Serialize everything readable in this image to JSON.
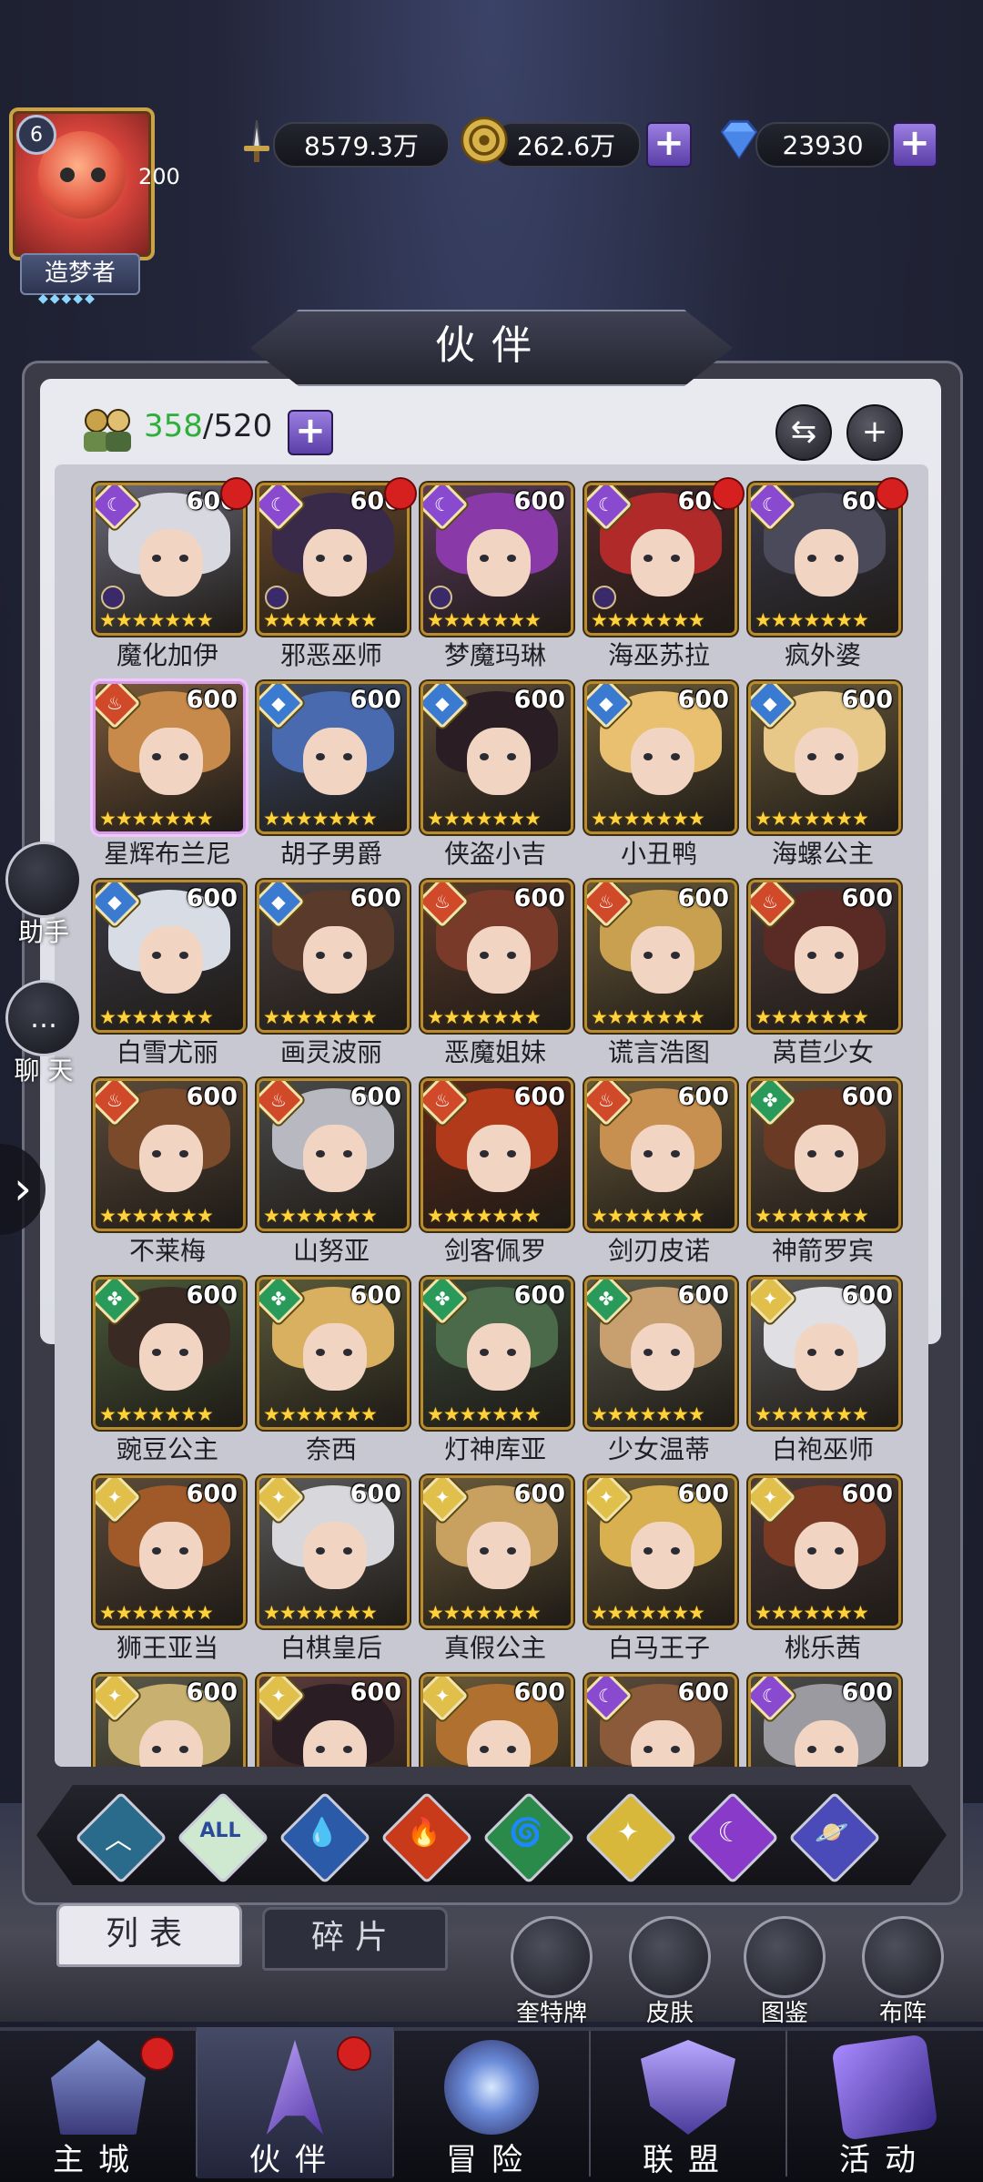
{
  "player": {
    "level": "6",
    "count": "200",
    "title": "造梦者"
  },
  "resources": {
    "power": "8579.3万",
    "gold": "262.6万",
    "diamonds": "23930"
  },
  "page": {
    "title": "伙伴",
    "owned": "358",
    "capacity": "/520"
  },
  "side": {
    "assistant": "助手",
    "chat": "聊 天"
  },
  "heroes": [
    {
      "name": "魔化加伊",
      "level": "600",
      "element": "moon",
      "dot": true,
      "bg": "#6a6a78",
      "hair": "#d8d8e0",
      "card": "gold"
    },
    {
      "name": "邪恶巫师",
      "level": "600",
      "element": "moon",
      "dot": true,
      "bg": "#6b4a2a",
      "hair": "#3a2a4a",
      "card": "gold"
    },
    {
      "name": "梦魔玛琳",
      "level": "600",
      "element": "moon",
      "dot": false,
      "bg": "#5a3a5a",
      "hair": "#8a3aa8",
      "card": "gold"
    },
    {
      "name": "海巫苏拉",
      "level": "600",
      "element": "moon",
      "dot": true,
      "bg": "#4a2a2a",
      "hair": "#b02a2a",
      "card": "gold"
    },
    {
      "name": "疯外婆",
      "level": "600",
      "element": "moon",
      "dot": true,
      "bg": "#3a3a4a",
      "hair": "#4a4a5a",
      "card": "gold"
    },
    {
      "name": "星辉布兰尼",
      "level": "600",
      "element": "fire",
      "dot": false,
      "bg": "#7a5a3a",
      "hair": "#c88a4a",
      "card": "pink"
    },
    {
      "name": "胡子男爵",
      "level": "600",
      "element": "water",
      "dot": false,
      "bg": "#3a4a6a",
      "hair": "#4a6ab0",
      "card": "gold"
    },
    {
      "name": "侠盗小吉",
      "level": "600",
      "element": "water",
      "dot": false,
      "bg": "#5a4a3a",
      "hair": "#2a1e24",
      "card": "gold"
    },
    {
      "name": "小丑鸭",
      "level": "600",
      "element": "water",
      "dot": false,
      "bg": "#6a5a3a",
      "hair": "#e8c070",
      "card": "gold"
    },
    {
      "name": "海螺公主",
      "level": "600",
      "element": "water",
      "dot": false,
      "bg": "#6a5a3a",
      "hair": "#e8c888",
      "card": "gold"
    },
    {
      "name": "白雪尤丽",
      "level": "600",
      "element": "water",
      "dot": false,
      "bg": "#3a3a44",
      "hair": "#d8dce4",
      "card": "gold"
    },
    {
      "name": "画灵波丽",
      "level": "600",
      "element": "water",
      "dot": false,
      "bg": "#4a4040",
      "hair": "#5a3a2a",
      "card": "gold"
    },
    {
      "name": "恶魔姐妹",
      "level": "600",
      "element": "fire",
      "dot": false,
      "bg": "#5a3a2a",
      "hair": "#7a3a2a",
      "card": "gold"
    },
    {
      "name": "谎言浩图",
      "level": "600",
      "element": "fire",
      "dot": false,
      "bg": "#6a5a3a",
      "hair": "#c8a050",
      "card": "gold"
    },
    {
      "name": "莴苣少女",
      "level": "600",
      "element": "fire",
      "dot": false,
      "bg": "#4a3a3a",
      "hair": "#5a2a24",
      "card": "gold"
    },
    {
      "name": "不莱梅",
      "level": "600",
      "element": "fire",
      "dot": false,
      "bg": "#5a4a3a",
      "hair": "#7a4a2a",
      "card": "gold"
    },
    {
      "name": "山努亚",
      "level": "600",
      "element": "fire",
      "dot": false,
      "bg": "#4a4a4a",
      "hair": "#b8b8c0",
      "card": "gold"
    },
    {
      "name": "剑客佩罗",
      "level": "600",
      "element": "fire",
      "dot": false,
      "bg": "#5a2a1a",
      "hair": "#b03a1a",
      "card": "gold"
    },
    {
      "name": "剑刃皮诺",
      "level": "600",
      "element": "fire",
      "dot": false,
      "bg": "#6a5a3a",
      "hair": "#c89050",
      "card": "gold"
    },
    {
      "name": "神箭罗宾",
      "level": "600",
      "element": "wind",
      "dot": false,
      "bg": "#5a4a3a",
      "hair": "#6a3a24",
      "card": "gold"
    },
    {
      "name": "豌豆公主",
      "level": "600",
      "element": "wind",
      "dot": false,
      "bg": "#4a5a3a",
      "hair": "#3a2a24",
      "card": "gold"
    },
    {
      "name": "奈西",
      "level": "600",
      "element": "wind",
      "dot": false,
      "bg": "#5a5a3a",
      "hair": "#d8b060",
      "card": "gold"
    },
    {
      "name": "灯神库亚",
      "level": "600",
      "element": "wind",
      "dot": false,
      "bg": "#3a4a3a",
      "hair": "#4a6a4a",
      "card": "gold"
    },
    {
      "name": "少女温蒂",
      "level": "600",
      "element": "wind",
      "dot": false,
      "bg": "#5a5a4a",
      "hair": "#c8a070",
      "card": "gold"
    },
    {
      "name": "白袍巫师",
      "level": "600",
      "element": "light",
      "dot": false,
      "bg": "#5a5a5a",
      "hair": "#e0e0e4",
      "card": "gold"
    },
    {
      "name": "狮王亚当",
      "level": "600",
      "element": "light",
      "dot": false,
      "bg": "#5a4a3a",
      "hair": "#a05a2a",
      "card": "gold"
    },
    {
      "name": "白棋皇后",
      "level": "600",
      "element": "light",
      "dot": false,
      "bg": "#5a5a5a",
      "hair": "#d8d8dc",
      "card": "gold"
    },
    {
      "name": "真假公主",
      "level": "600",
      "element": "light",
      "dot": false,
      "bg": "#6a5a3a",
      "hair": "#c8a060",
      "card": "gold"
    },
    {
      "name": "白马王子",
      "level": "600",
      "element": "light",
      "dot": false,
      "bg": "#6a5a3a",
      "hair": "#d8b050",
      "card": "gold"
    },
    {
      "name": "桃乐茜",
      "level": "600",
      "element": "light",
      "dot": false,
      "bg": "#4a3a3a",
      "hair": "#7a3a24",
      "card": "gold"
    },
    {
      "name": "",
      "level": "600",
      "element": "light",
      "dot": false,
      "bg": "#5a5a4a",
      "hair": "#c8b070",
      "card": "gold"
    },
    {
      "name": "",
      "level": "600",
      "element": "light",
      "dot": false,
      "bg": "#5a3a3a",
      "hair": "#2a1e24",
      "card": "gold"
    },
    {
      "name": "",
      "level": "600",
      "element": "light",
      "dot": false,
      "bg": "#6a5a3a",
      "hair": "#b07030",
      "card": "gold"
    },
    {
      "name": "",
      "level": "600",
      "element": "moon",
      "dot": false,
      "bg": "#5a4a3a",
      "hair": "#8a5a3a",
      "card": "gold"
    },
    {
      "name": "",
      "level": "600",
      "element": "moon",
      "dot": false,
      "bg": "#4a4a4a",
      "hair": "#9a9aa0",
      "card": "gold"
    }
  ],
  "filters": [
    {
      "id": "all-chevron",
      "label": "",
      "color": "#2a6a8a",
      "glyph": "︿"
    },
    {
      "id": "all",
      "label": "ALL",
      "color": "#cfe8d0",
      "glyph": ""
    },
    {
      "id": "water",
      "label": "",
      "color": "#2a5aa8",
      "glyph": "💧"
    },
    {
      "id": "fire",
      "label": "",
      "color": "#c83a1a",
      "glyph": "🔥"
    },
    {
      "id": "wind",
      "label": "",
      "color": "#2a8a4a",
      "glyph": "🌀"
    },
    {
      "id": "light",
      "label": "",
      "color": "#d8b83a",
      "glyph": "✦"
    },
    {
      "id": "moon",
      "label": "",
      "color": "#8a3ac8",
      "glyph": "☾"
    },
    {
      "id": "planet",
      "label": "",
      "color": "#4a4ab8",
      "glyph": "🪐"
    }
  ],
  "tabs": {
    "list": "列表",
    "fragments": "碎片"
  },
  "actions": {
    "cards": "奎特牌",
    "skins": "皮肤",
    "codex": "图鉴",
    "formation": "布阵"
  },
  "nav": {
    "city": "主城",
    "partners": "伙伴",
    "adventure": "冒险",
    "alliance": "联盟",
    "events": "活动"
  },
  "colors": {
    "moon": "#8a4ad0",
    "fire": "#d04a2a",
    "water": "#3a7ad0",
    "wind": "#2a9a5a",
    "light": "#e0c04a"
  }
}
